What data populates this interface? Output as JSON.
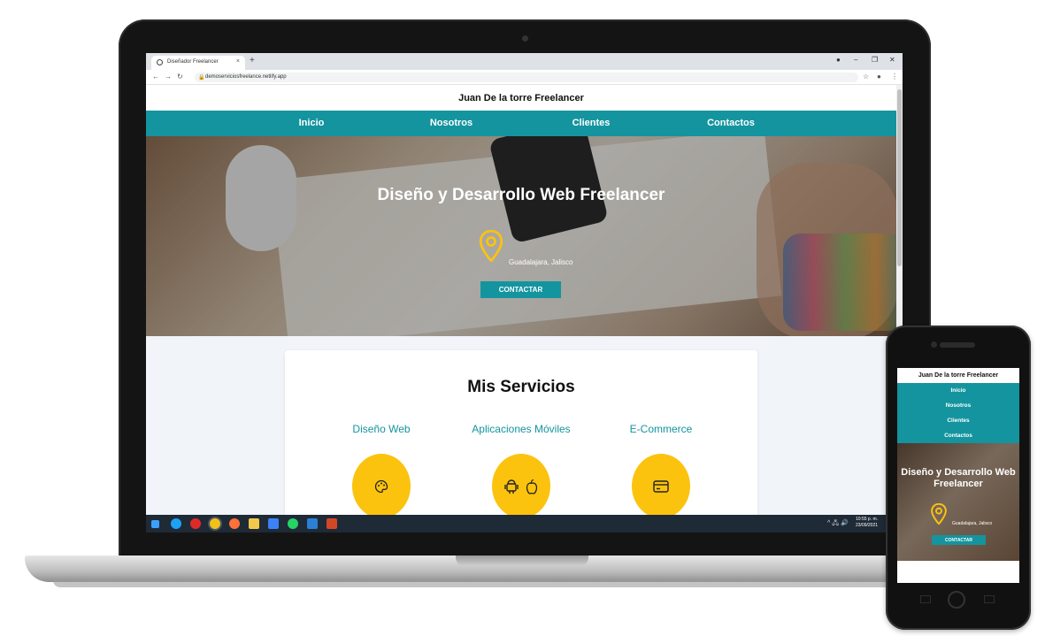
{
  "browser": {
    "tab_title": "Diseñador Freelancer",
    "tab_close": "×",
    "new_tab": "+",
    "url": "demoserviciosfreelance.netlify.app",
    "back": "←",
    "forward": "→",
    "reload": "↻",
    "bookmark": "☆",
    "menu": "⋮",
    "minimize": "–",
    "restore": "❐",
    "close": "✕"
  },
  "site": {
    "title": "Juan De la torre Freelancer",
    "nav": [
      "Inicio",
      "Nosotros",
      "Clientes",
      "Contactos"
    ],
    "hero_heading": "Diseño y Desarrollo Web Freelancer",
    "location": "Guadalajara, Jalisco",
    "cta": "CONTACTAR",
    "services_heading": "Mis Servicios",
    "services": [
      {
        "name": "Diseño Web",
        "icon": "palette-icon"
      },
      {
        "name": "Aplicaciones Móviles",
        "icon": "android-apple-icon"
      },
      {
        "name": "E-Commerce",
        "icon": "credit-card-icon"
      }
    ]
  },
  "taskbar": {
    "time": "10:55 p. m.",
    "date": "23/09/2021",
    "tray": "^ 🖧 🔊"
  },
  "colors": {
    "teal": "#14949e",
    "yellow": "#fcc30e",
    "light_bg": "#f1f4f9"
  }
}
